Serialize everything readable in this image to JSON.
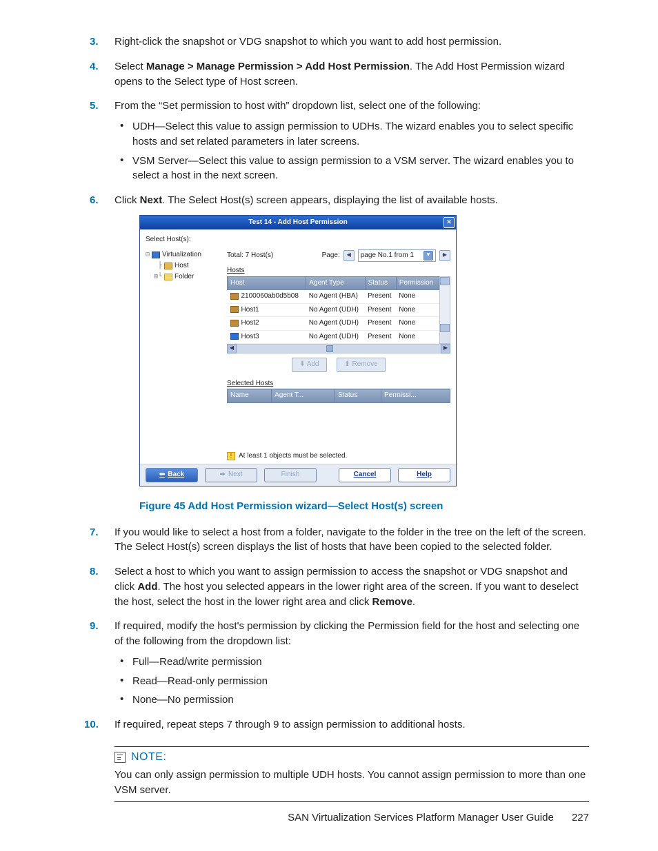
{
  "steps": {
    "s3": "Right-click the snapshot or VDG snapshot to which you want to add host permission.",
    "s4_pre": "Select ",
    "s4_bold": "Manage > Manage Permission > Add Host Permission",
    "s4_post": ". The Add Host Permission wizard opens to the Select type of Host screen.",
    "s5": "From the “Set permission to host with” dropdown list, select one of the following:",
    "s5_a": "UDH—Select this value to assign permission to UDHs. The wizard enables you to select specific hosts and set related parameters in later screens.",
    "s5_b": "VSM Server—Select this value to assign permission to a VSM server. The wizard enables you to select a host in the next screen.",
    "s6_pre": "Click ",
    "s6_bold": "Next",
    "s6_post": ". The Select Host(s) screen appears, displaying the list of available hosts.",
    "s7": "If you would like to select a host from a folder, navigate to the folder in the tree on the left of the screen. The Select Host(s) screen displays the list of hosts that have been copied to the selected folder.",
    "s8_a": "Select a host to which you want to assign permission to access the snapshot or VDG snapshot and click ",
    "s8_b": "Add",
    "s8_c": ". The host you selected appears in the lower right area of the screen. If you want to deselect the host, select the host in the lower right area and click ",
    "s8_d": "Remove",
    "s8_e": ".",
    "s9": "If required, modify the host's permission by clicking the Permission field for the host and selecting one of the following from the dropdown list:",
    "s9_a": "Full—Read/write permission",
    "s9_b": "Read—Read-only permission",
    "s9_c": "None—No permission",
    "s10": "If required, repeat steps 7 through 9 to assign permission to additional hosts."
  },
  "wizard": {
    "title": "Test 14 - Add Host Permission",
    "select_label": "Select Host(s):",
    "tree": {
      "root": "Virtualization",
      "host": "Host",
      "folder": "Folder"
    },
    "total": "Total: 7 Host(s)",
    "page_label": "Page:",
    "page_select": "page No.1 from 1",
    "hosts_label": "Hosts",
    "columns": [
      "Host",
      "Agent Type",
      "Status",
      "Permission"
    ],
    "rows": [
      {
        "host": "2100060ab0d5b08",
        "agent": "No Agent (HBA)",
        "status": "Present",
        "perm": "None"
      },
      {
        "host": "Host1",
        "agent": "No Agent (UDH)",
        "status": "Present",
        "perm": "None"
      },
      {
        "host": "Host2",
        "agent": "No Agent (UDH)",
        "status": "Present",
        "perm": "None"
      },
      {
        "host": "Host3",
        "agent": "No Agent (UDH)",
        "status": "Present",
        "perm": "None"
      }
    ],
    "add_btn": "Add",
    "remove_btn": "Remove",
    "selected_label": "Selected Hosts",
    "sel_columns": [
      "Name",
      "Agent T...",
      "Status",
      "Permissi..."
    ],
    "warning": "At least 1 objects must be selected.",
    "back": "Back",
    "next": "Next",
    "finish": "Finish",
    "cancel": "Cancel",
    "help": "Help"
  },
  "figure_caption": "Figure 45 Add Host Permission wizard—Select Host(s) screen",
  "note": {
    "title": "NOTE:",
    "text": "You can only assign permission to multiple UDH hosts. You cannot assign permission to more than one VSM server."
  },
  "footer": {
    "doc": "SAN Virtualization Services Platform Manager User Guide",
    "page": "227"
  }
}
